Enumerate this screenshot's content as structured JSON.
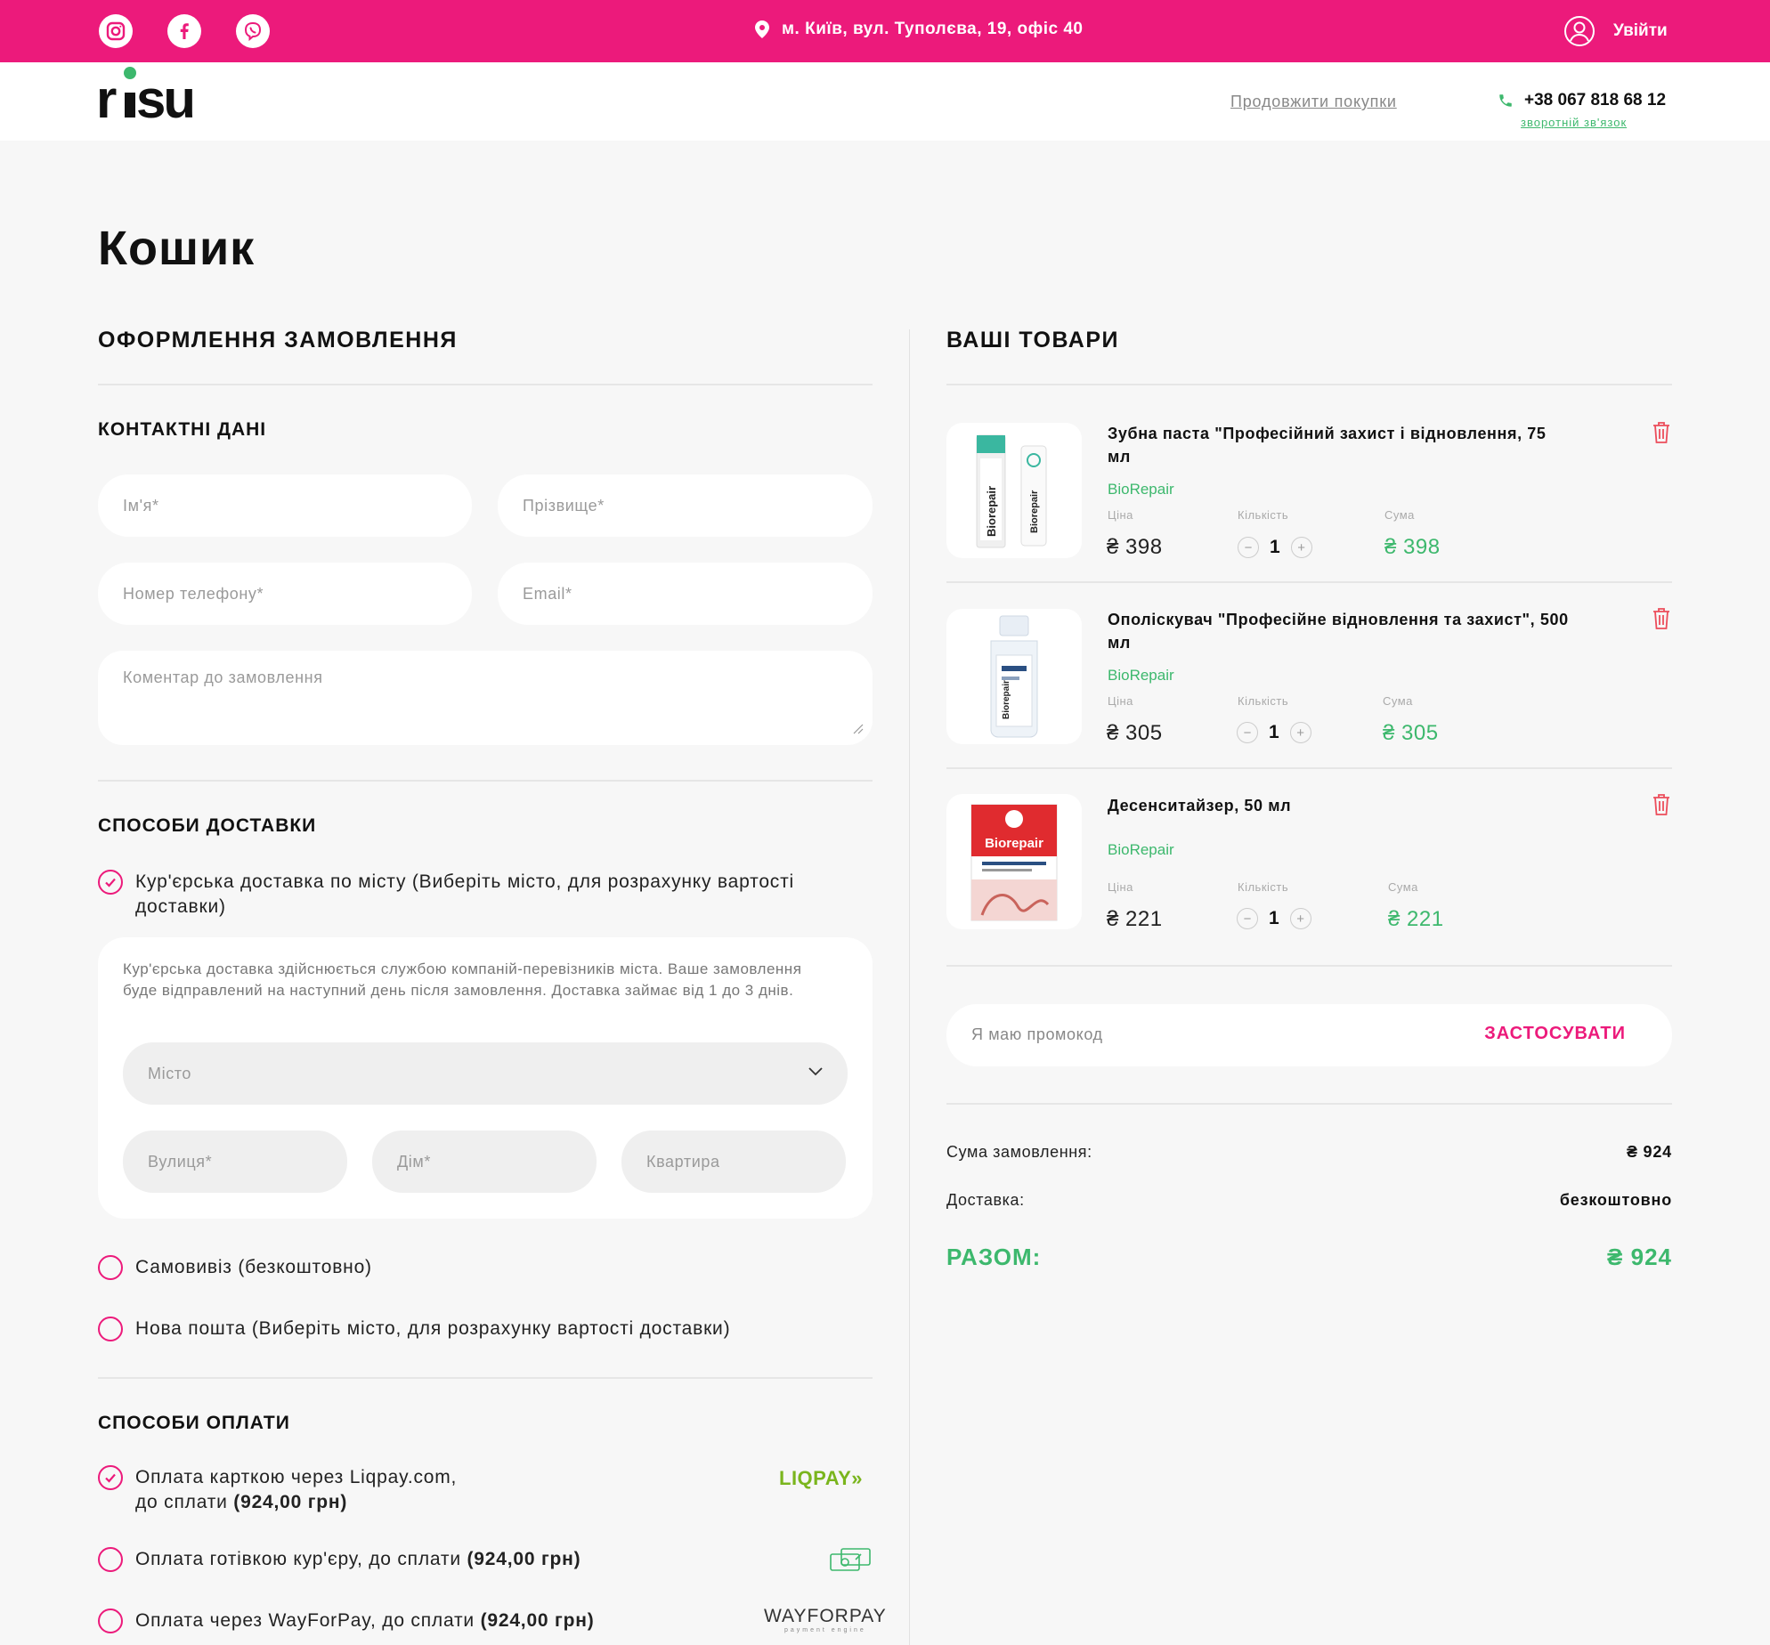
{
  "colors": {
    "brand": "#ec1a7b",
    "accent_green": "#3db86d"
  },
  "topbar": {
    "social_icons": [
      "instagram-icon",
      "facebook-icon",
      "viber-icon"
    ],
    "address": "м. Київ, вул. Туполєва, 19, офіс 40",
    "login_label": "Увійти"
  },
  "header": {
    "logo_text": "risu",
    "continue_link": "Продовжити покупки",
    "phone": "+38 067 818 68 12",
    "callback_link": "зворотній зв'язок"
  },
  "page_title": "Кошик",
  "checkout": {
    "title": "ОФОРМЛЕННЯ ЗАМОВЛЕННЯ",
    "contacts": {
      "title": "КОНТАКТНІ ДАНІ",
      "first_name_ph": "Ім'я*",
      "last_name_ph": "Прізвище*",
      "phone_ph": "Номер телефону*",
      "email_ph": "Email*",
      "comment_ph": "Коментар до замовлення"
    },
    "delivery": {
      "title": "СПОСОБИ ДОСТАВКИ",
      "options": [
        {
          "label": "Кур'єрська доставка по місту (Виберіть місто, для розрахунку вартості доставки)",
          "selected": true
        },
        {
          "label": "Самовивіз (безкоштовно)",
          "selected": false
        },
        {
          "label": "Нова пошта (Виберіть місто, для розрахунку вартості доставки)",
          "selected": false
        }
      ],
      "courier_info": "Кур'єрська доставка здійснюється службою компаній-перевізників міста. Ваше замовлення буде відправлений на наступний день після замовлення. Доставка займає від 1 до 3 днів.",
      "city_ph": "Місто",
      "street_ph": "Вулиця*",
      "house_ph": "Дім*",
      "apartment_ph": "Квартира"
    },
    "payment": {
      "title": "СПОСОБИ ОПЛАТИ",
      "options": [
        {
          "label_1": "Оплата карткою через Liqpay.com,",
          "label_2": "до сплати ",
          "amount": "(924,00 грн)",
          "selected": true,
          "logo": "LIQPAY"
        },
        {
          "label_1": "Оплата готівкою кур'єру, до сплати ",
          "amount": "(924,00 грн)",
          "selected": false,
          "logo": "cash-icon"
        },
        {
          "label_1": "Оплата через WayForPay, до сплати ",
          "amount": "(924,00 грн)",
          "selected": false,
          "logo": "WAYFORPAY",
          "logo_sub": "payment engine"
        }
      ]
    }
  },
  "cart": {
    "title": "ВАШІ ТОВАРИ",
    "labels": {
      "price": "Ціна",
      "qty": "Кількість",
      "sum": "Сума"
    },
    "items": [
      {
        "name": "Зубна паста \"Професійний захист і відновлення, 75 мл",
        "brand": "BioRepair",
        "price": "₴ 398",
        "qty": "1",
        "sum": "₴ 398",
        "image": "toothpaste-image"
      },
      {
        "name": "Ополіскувач \"Професійне відновлення та захист\", 500 мл",
        "brand": "BioRepair",
        "price": "₴ 305",
        "qty": "1",
        "sum": "₴ 305",
        "image": "mouthwash-image"
      },
      {
        "name": "Десенситайзер, 50 мл",
        "brand": "BioRepair",
        "price": "₴ 221",
        "qty": "1",
        "sum": "₴ 221",
        "image": "desensitizer-image"
      }
    ],
    "promo_ph": "Я маю промокод",
    "promo_btn": "ЗАСТОСУВАТИ",
    "summary": {
      "order_sum_label": "Сума замовлення:",
      "order_sum": "₴ 924",
      "delivery_label": "Доставка:",
      "delivery_value": "безкоштовно",
      "total_label": "РАЗОМ:",
      "total_value": "₴ 924"
    }
  }
}
